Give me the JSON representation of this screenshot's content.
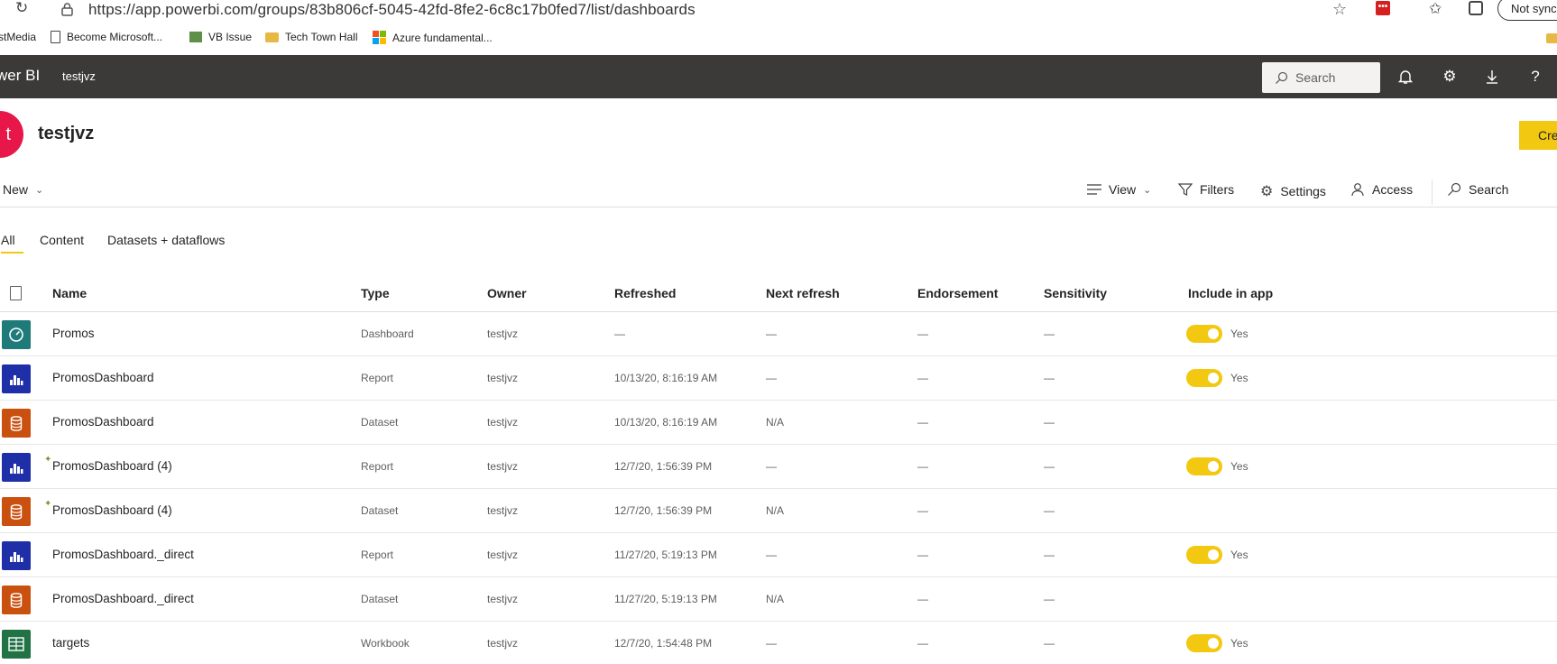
{
  "browser": {
    "url": "https://app.powerbi.com/groups/83b806cf-5045-42fd-8fe2-6c8c17b0fed7/list/dashboards",
    "sync_label": "Not sync",
    "bookmarks": [
      {
        "label": "stMedia",
        "icon": "none"
      },
      {
        "label": "Become Microsoft...",
        "icon": "page-icon"
      },
      {
        "label": "VB Issue",
        "icon": "vb-icon"
      },
      {
        "label": "Tech Town Hall",
        "icon": "folder-icon"
      },
      {
        "label": "Azure fundamental...",
        "icon": "microsoft-icon"
      }
    ]
  },
  "header": {
    "brand": "wer BI",
    "workspace": "testjvz",
    "search_label": "Search"
  },
  "workspace": {
    "avatar_letter": "t",
    "title": "testjvz",
    "create_label": "Cre"
  },
  "commandbar": {
    "new_label": "New",
    "view_label": "View",
    "filters_label": "Filters",
    "settings_label": "Settings",
    "access_label": "Access",
    "search_label": "Search"
  },
  "tabs": [
    "All",
    "Content",
    "Datasets + dataflows"
  ],
  "table": {
    "columns": [
      "Name",
      "Type",
      "Owner",
      "Refreshed",
      "Next refresh",
      "Endorsement",
      "Sensitivity",
      "Include in app"
    ],
    "rows": [
      {
        "name": "Promos",
        "type": "Dashboard",
        "owner": "testjvz",
        "refreshed": "—",
        "next": "—",
        "endorsement": "—",
        "sensitivity": "—",
        "include": "Yes",
        "icon_color": "#1f7a7a",
        "kind": "dashboard",
        "new": false
      },
      {
        "name": "PromosDashboard",
        "type": "Report",
        "owner": "testjvz",
        "refreshed": "10/13/20, 8:16:19 AM",
        "next": "—",
        "endorsement": "—",
        "sensitivity": "—",
        "include": "Yes",
        "icon_color": "#1f2fa8",
        "kind": "report",
        "new": false
      },
      {
        "name": "PromosDashboard",
        "type": "Dataset",
        "owner": "testjvz",
        "refreshed": "10/13/20, 8:16:19 AM",
        "next": "N/A",
        "endorsement": "—",
        "sensitivity": "—",
        "include": "",
        "icon_color": "#ca5010",
        "kind": "dataset",
        "new": false
      },
      {
        "name": "PromosDashboard (4)",
        "type": "Report",
        "owner": "testjvz",
        "refreshed": "12/7/20, 1:56:39 PM",
        "next": "—",
        "endorsement": "—",
        "sensitivity": "—",
        "include": "Yes",
        "icon_color": "#1f2fa8",
        "kind": "report",
        "new": true
      },
      {
        "name": "PromosDashboard (4)",
        "type": "Dataset",
        "owner": "testjvz",
        "refreshed": "12/7/20, 1:56:39 PM",
        "next": "N/A",
        "endorsement": "—",
        "sensitivity": "—",
        "include": "",
        "icon_color": "#ca5010",
        "kind": "dataset",
        "new": true
      },
      {
        "name": "PromosDashboard._direct",
        "type": "Report",
        "owner": "testjvz",
        "refreshed": "11/27/20, 5:19:13 PM",
        "next": "—",
        "endorsement": "—",
        "sensitivity": "—",
        "include": "Yes",
        "icon_color": "#1f2fa8",
        "kind": "report",
        "new": false
      },
      {
        "name": "PromosDashboard._direct",
        "type": "Dataset",
        "owner": "testjvz",
        "refreshed": "11/27/20, 5:19:13 PM",
        "next": "N/A",
        "endorsement": "—",
        "sensitivity": "—",
        "include": "",
        "icon_color": "#ca5010",
        "kind": "dataset",
        "new": false
      },
      {
        "name": "targets",
        "type": "Workbook",
        "owner": "testjvz",
        "refreshed": "12/7/20, 1:54:48 PM",
        "next": "—",
        "endorsement": "—",
        "sensitivity": "—",
        "include": "Yes",
        "icon_color": "#217346",
        "kind": "workbook",
        "new": false
      }
    ]
  },
  "colors": {
    "accent": "#f2c811",
    "header_bg": "#3b3a39",
    "avatar": "#e8174a"
  }
}
